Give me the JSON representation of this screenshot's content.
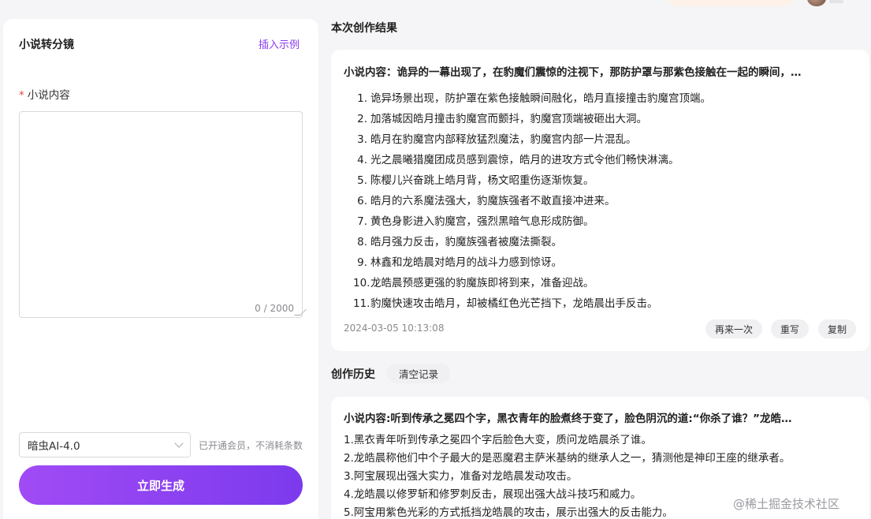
{
  "editor": {
    "title": "小说转分镜",
    "insert_example": "插入示例",
    "field_required_mark": "*",
    "field_label": "小说内容",
    "textarea_value": "",
    "char_count": "0 / 2000",
    "model_value": "暗虫AI-4.0",
    "member_note": "已开通会员，不消耗条数",
    "generate_label": "立即生成"
  },
  "result": {
    "section_title": "本次创作结果",
    "heading": "小说内容：诡异的一幕出现了，在豹魔们震惊的注视下，那防护罩与那紫色接触在一起的瞬间，…",
    "items": [
      {
        "num": "1.",
        "text": "诡异场景出现，防护罩在紫色接触瞬间融化，皓月直接撞击豹魔宫顶端。"
      },
      {
        "num": "2.",
        "text": "加落城因皓月撞击豹魔宫而颤抖，豹魔宫顶端被砸出大洞。"
      },
      {
        "num": "3.",
        "text": "皓月在豹魔宫内部释放猛烈魔法，豹魔宫内部一片混乱。"
      },
      {
        "num": "4.",
        "text": "光之晨曦猎魔团成员感到震惊，皓月的进攻方式令他们畅快淋漓。"
      },
      {
        "num": "5.",
        "text": "陈樱儿兴奋跳上皓月背，杨文昭重伤逐渐恢复。"
      },
      {
        "num": "6.",
        "text": "皓月的六系魔法强大，豹魔族强者不敢直接冲进来。"
      },
      {
        "num": "7.",
        "text": "黄色身影进入豹魔宫，强烈黑暗气息形成防御。"
      },
      {
        "num": "8.",
        "text": "皓月强力反击，豹魔族强者被魔法撕裂。"
      },
      {
        "num": "9.",
        "text": "林鑫和龙皓晨对皓月的战斗力感到惊讶。"
      },
      {
        "num": "10.",
        "text": "龙皓晨预感更强的豹魔族即将到来，准备迎战。"
      },
      {
        "num": "11.",
        "text": "豹魔快速攻击皓月，却被橘红色光芒挡下，龙皓晨出手反击。"
      }
    ],
    "timestamp": "2024-03-05 10:13:08",
    "actions": {
      "retry": "再来一次",
      "rewrite": "重写",
      "copy": "复制"
    }
  },
  "history": {
    "section_title": "创作历史",
    "clear_label": "清空记录",
    "heading": "小说内容:听到传承之冕四个字，黑衣青年的脸煮终于变了，脸色阴沉的道:“你杀了谁？”龙皓…",
    "items": [
      "1.黑衣青年听到传承之冕四个字后脸色大变，质问龙皓晨杀了谁。",
      "2.龙皓晨称他们中个子最大的是恶魔君主萨米基纳的继承人之一，猜测他是神印王座的继承者。",
      "3.阿宝展现出强大实力，准备对龙皓晨发动攻击。",
      "4.龙皓晨以修罗斩和修罗刺反击，展现出强大战斗技巧和威力。",
      "5.阿宝用紫色光彩的方式抵挡龙皓晨的攻击，展示出强大的反击能力。"
    ]
  },
  "watermark": "@稀土掘金技术社区",
  "colors": {
    "accent": "#8b3cf0",
    "required": "#e5484d",
    "button_start": "#a14bf5",
    "button_end": "#7c3aed"
  }
}
